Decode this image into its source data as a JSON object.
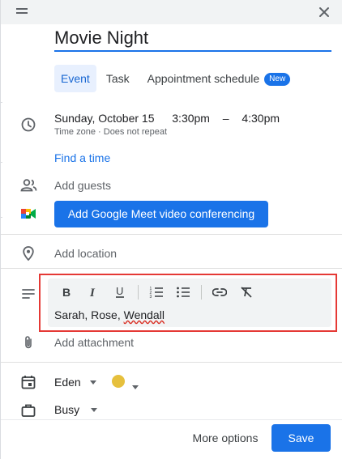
{
  "title_field": {
    "value": "Movie Night"
  },
  "tabs": [
    {
      "label": "Event"
    },
    {
      "label": "Task"
    },
    {
      "label": "Appointment schedule",
      "badge": "New"
    }
  ],
  "datetime": {
    "date": "Sunday, October 15",
    "start": "3:30pm",
    "dash": "–",
    "end": "4:30pm",
    "timezone": "Time zone",
    "separator": "·",
    "repeat": "Does not repeat"
  },
  "find_time": "Find a time",
  "guests": {
    "placeholder": "Add guests"
  },
  "meet": {
    "label": "Add Google Meet video conferencing"
  },
  "location": {
    "placeholder": "Add location"
  },
  "description": {
    "text_before": "Sarah, Rose, ",
    "text_flagged": "Wendall"
  },
  "attachment": {
    "label": "Add attachment"
  },
  "calendar": {
    "name": "Eden",
    "color": "#e6c03d"
  },
  "availability": {
    "value": "Busy"
  },
  "footer": {
    "more_options": "More options",
    "save": "Save"
  },
  "colors": {
    "accent": "#1a73e8",
    "highlight_frame": "#e53935"
  }
}
